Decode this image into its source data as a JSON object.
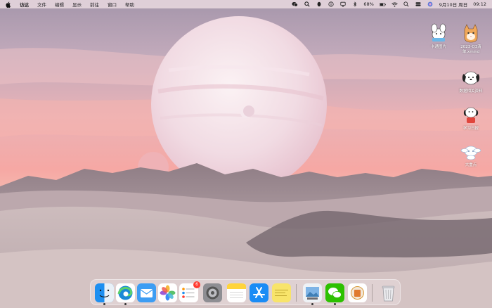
{
  "menubar": {
    "app_name": "访达",
    "menu_items": [
      "文件",
      "编辑",
      "显示",
      "前往",
      "窗口",
      "帮助"
    ],
    "status_icons": [
      "wechat-icon",
      "search-icon",
      "qq-icon",
      "info-icon",
      "airplay-icon",
      "bluetooth-icon"
    ],
    "battery_percent": "68%",
    "date": "9月10日 周日",
    "time": "09:12"
  },
  "desktop": {
    "icons": [
      {
        "label": "卡通图片",
        "icon": "cartoon-folder-icon"
      },
      {
        "label": "2023-Q3清单.xmind",
        "icon": "cat-file-icon"
      },
      {
        "label": "数据相关资料",
        "icon": "pochacco-folder-icon"
      },
      {
        "label": "学习日报",
        "icon": "pochacco-red-icon"
      },
      {
        "label": "大重点",
        "icon": "cinnamoroll-icon"
      }
    ]
  },
  "dock": {
    "apps": [
      {
        "name": "Finder",
        "icon": "finder-icon",
        "running": true
      },
      {
        "name": "Microsoft Edge",
        "icon": "edge-icon",
        "running": true
      },
      {
        "name": "Mail",
        "icon": "mail-icon",
        "running": false
      },
      {
        "name": "Photos",
        "icon": "photos-icon",
        "running": false
      },
      {
        "name": "Reminders",
        "icon": "reminders-icon",
        "running": false,
        "badge": "6"
      },
      {
        "name": "System Preferences",
        "icon": "settings-icon",
        "running": false
      },
      {
        "name": "Notes",
        "icon": "notes-icon",
        "running": false
      },
      {
        "name": "App Store",
        "icon": "app-store-icon",
        "running": false
      },
      {
        "name": "Stickies",
        "icon": "stickies-icon",
        "running": false
      },
      {
        "name": "Preview",
        "icon": "preview-icon",
        "running": true
      },
      {
        "name": "WeChat",
        "icon": "wechat-icon",
        "running": true
      },
      {
        "name": "Calendar Widget",
        "icon": "calendar-widget-icon",
        "running": false
      },
      {
        "name": "Trash",
        "icon": "trash-icon",
        "running": false
      }
    ]
  },
  "colors": {
    "sky_top": "#b2a2b4",
    "sky_glow": "#f2a5a5",
    "planet": "#f0e4ea",
    "sand": "#c9b8b9",
    "menubar_bg": "#ecdce2",
    "badge": "#ff3b30"
  }
}
